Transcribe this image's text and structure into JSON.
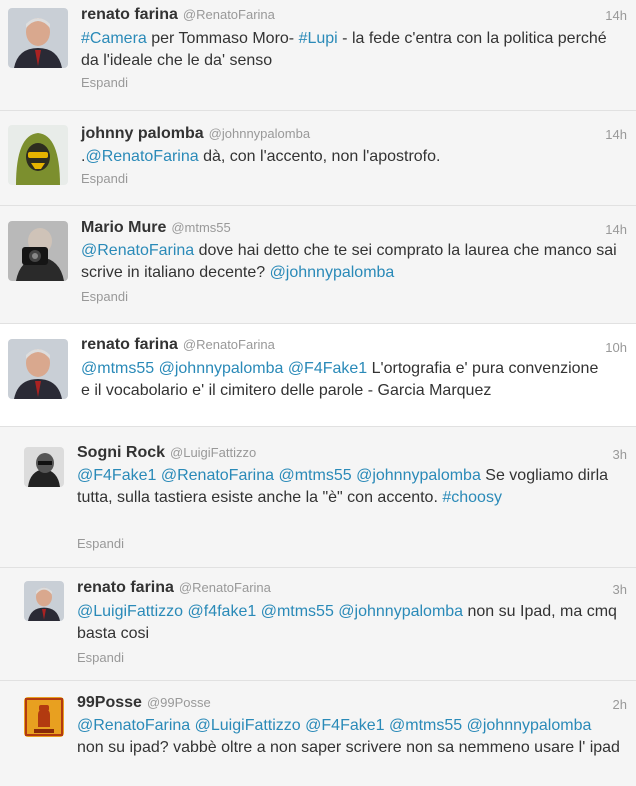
{
  "tweets": [
    {
      "name": "renato farina",
      "handle": "@RenatoFarina",
      "time": "14h",
      "text_parts": [
        {
          "t": "#Camera",
          "link": true
        },
        {
          "t": " per Tommaso Moro- ",
          "link": false
        },
        {
          "t": "#Lupi",
          "link": true
        },
        {
          "t": " - la fede c'entra con la politica perché da l'ideale che le da' senso",
          "link": false
        }
      ],
      "expand": "Espandi",
      "avatar_icon": "renato-farina-avatar"
    },
    {
      "name": "johnny palomba",
      "handle": "@johnnypalomba",
      "time": "14h",
      "text_parts": [
        {
          "t": ".",
          "link": false
        },
        {
          "t": "@RenatoFarina",
          "link": true
        },
        {
          "t": " dà, con l'accento, non l'apostrofo.",
          "link": false
        }
      ],
      "expand": "Espandi",
      "avatar_icon": "johnny-palomba-avatar"
    },
    {
      "name": "Mario Mure",
      "handle": "@mtms55",
      "time": "14h",
      "text_parts": [
        {
          "t": "@RenatoFarina",
          "link": true
        },
        {
          "t": " dove hai detto che te sei comprato la laurea che manco sai scrive in italiano decente? ",
          "link": false
        },
        {
          "t": "@johnnypalomba",
          "link": true
        }
      ],
      "expand": "Espandi",
      "avatar_icon": "mario-mure-avatar"
    },
    {
      "name": "renato farina",
      "handle": "@RenatoFarina",
      "time": "10h",
      "text_parts": [
        {
          "t": "@mtms55",
          "link": true
        },
        {
          "t": " ",
          "link": false
        },
        {
          "t": "@johnnypalomba",
          "link": true
        },
        {
          "t": " ",
          "link": false
        },
        {
          "t": "@F4Fake1",
          "link": true
        },
        {
          "t": " L'ortografia e' pura convenzione e il vocabolario e' il cimitero delle parole - Garcia Marquez",
          "link": false
        }
      ],
      "expand": "",
      "avatar_icon": "renato-farina-avatar"
    },
    {
      "name": "Sogni Rock",
      "handle": "@LuigiFattizzo",
      "time": "3h",
      "text_parts": [
        {
          "t": "@F4Fake1",
          "link": true
        },
        {
          "t": " ",
          "link": false
        },
        {
          "t": "@RenatoFarina",
          "link": true
        },
        {
          "t": " ",
          "link": false
        },
        {
          "t": "@mtms55",
          "link": true
        },
        {
          "t": " ",
          "link": false
        },
        {
          "t": "@johnnypalomba",
          "link": true
        },
        {
          "t": " Se vogliamo dirla tutta, sulla tastiera esiste anche la \"è\" con accento. ",
          "link": false
        },
        {
          "t": "#choosy",
          "link": true
        }
      ],
      "expand": "Espandi",
      "avatar_icon": "sogni-rock-avatar"
    },
    {
      "name": "renato farina",
      "handle": "@RenatoFarina",
      "time": "3h",
      "text_parts": [
        {
          "t": "@LuigiFattizzo",
          "link": true
        },
        {
          "t": " ",
          "link": false
        },
        {
          "t": "@f4fake1",
          "link": true
        },
        {
          "t": " ",
          "link": false
        },
        {
          "t": "@mtms55",
          "link": true
        },
        {
          "t": " ",
          "link": false
        },
        {
          "t": "@johnnypalomba",
          "link": true
        },
        {
          "t": " non su Ipad, ma cmq basta cosi",
          "link": false
        }
      ],
      "expand": "Espandi",
      "avatar_icon": "renato-farina-avatar"
    },
    {
      "name": "99Posse",
      "handle": "@99Posse",
      "time": "2h",
      "text_parts": [
        {
          "t": "@RenatoFarina",
          "link": true
        },
        {
          "t": " ",
          "link": false
        },
        {
          "t": "@LuigiFattizzo",
          "link": true
        },
        {
          "t": " ",
          "link": false
        },
        {
          "t": "@F4Fake1",
          "link": true
        },
        {
          "t": " ",
          "link": false
        },
        {
          "t": "@mtms55",
          "link": true
        },
        {
          "t": " ",
          "link": false
        },
        {
          "t": "@johnnypalomba",
          "link": true
        },
        {
          "t": " non su ipad? vabbè oltre a non saper scrivere non sa nemmeno usare l' ipad",
          "link": false
        }
      ],
      "expand": "",
      "avatar_icon": "99posse-avatar"
    }
  ],
  "colors": {
    "link": "#2a8ab8",
    "muted": "#999999",
    "text": "#333333",
    "background": "#f5f5f5",
    "focused": "#ffffff"
  }
}
